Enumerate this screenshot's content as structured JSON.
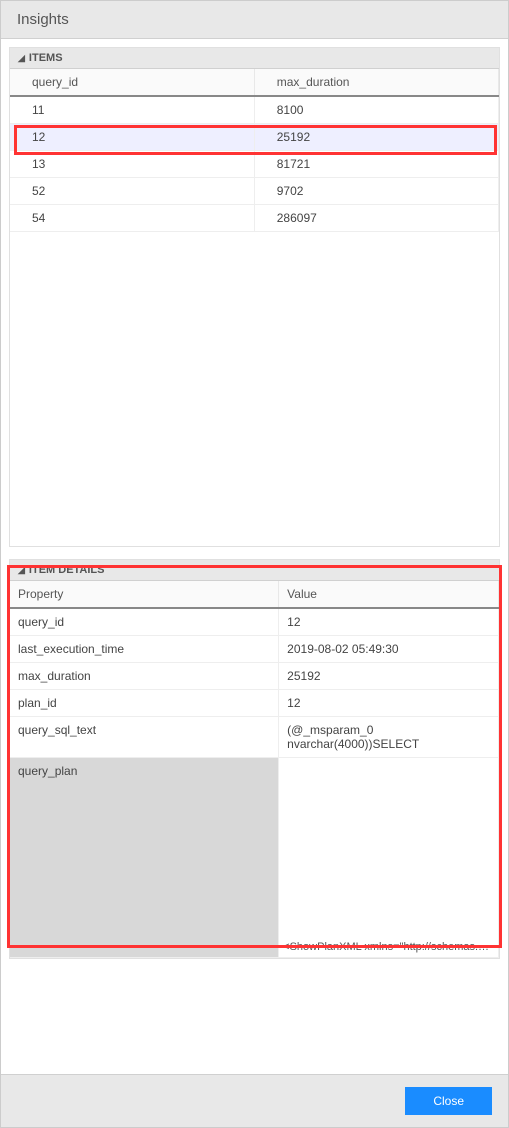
{
  "header": {
    "title": "Insights"
  },
  "items_section": {
    "label": "ITEMS",
    "columns": {
      "col1": "query_id",
      "col2": "max_duration"
    },
    "rows": [
      {
        "query_id": "11",
        "max_duration": "8100"
      },
      {
        "query_id": "12",
        "max_duration": "25192"
      },
      {
        "query_id": "13",
        "max_duration": "81721"
      },
      {
        "query_id": "52",
        "max_duration": "9702"
      },
      {
        "query_id": "54",
        "max_duration": "286097"
      }
    ]
  },
  "details_section": {
    "label": "ITEM DETAILS",
    "columns": {
      "col1": "Property",
      "col2": "Value"
    },
    "rows": [
      {
        "property": "query_id",
        "value": "12"
      },
      {
        "property": "last_execution_time",
        "value": "2019-08-02 05:49:30"
      },
      {
        "property": "max_duration",
        "value": "25192"
      },
      {
        "property": "plan_id",
        "value": "12"
      },
      {
        "property": "query_sql_text",
        "value": "(@_msparam_0 nvarchar(4000))SELECT"
      },
      {
        "property": "query_plan",
        "value": ""
      }
    ],
    "plan_xml": "<ShowPlanXML xmlns=\"http://schemas.microsof..."
  },
  "footer": {
    "close_label": "Close"
  }
}
